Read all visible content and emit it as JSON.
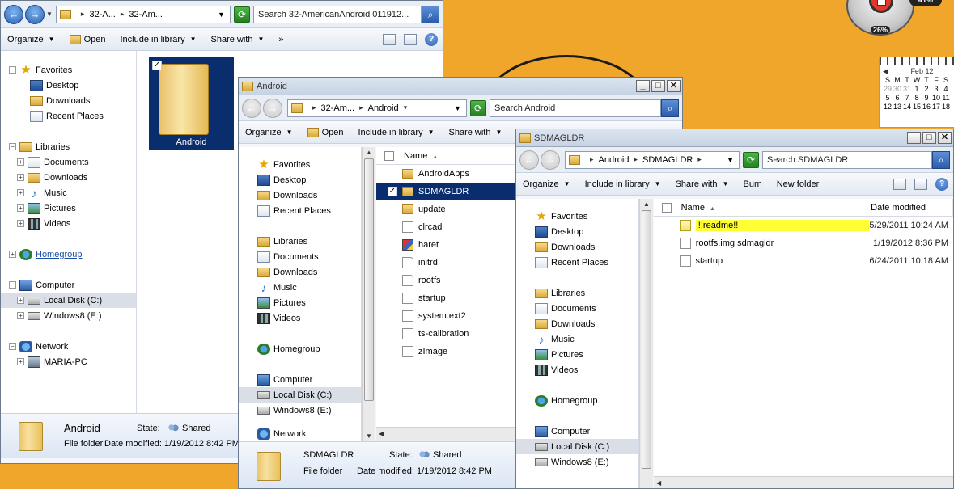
{
  "desktop": {
    "cpu_percent": "26%",
    "mem_percent": "41%",
    "calendar": {
      "month": "Feb 12",
      "weekdays": [
        "S",
        "M",
        "T",
        "W",
        "T",
        "F",
        "S"
      ],
      "rows": [
        [
          "29",
          "30",
          "31",
          "1",
          "2",
          "3",
          "4"
        ],
        [
          "5",
          "6",
          "7",
          "8",
          "9",
          "10",
          "11"
        ],
        [
          "12",
          "13",
          "14",
          "15",
          "16",
          "17",
          "18"
        ]
      ]
    }
  },
  "win1": {
    "crumbs": [
      "32-A...",
      "32-Am..."
    ],
    "search_placeholder": "Search 32-AmericanAndroid 011912...",
    "cmd": {
      "organize": "Organize",
      "open": "Open",
      "include": "Include in library",
      "share": "Share with",
      "more": "»"
    },
    "nav": {
      "favorites": "Favorites",
      "desktop": "Desktop",
      "downloads": "Downloads",
      "recent": "Recent Places",
      "libraries": "Libraries",
      "documents": "Documents",
      "lib_downloads": "Downloads",
      "music": "Music",
      "pictures": "Pictures",
      "videos": "Videos",
      "homegroup": "Homegroup",
      "computer": "Computer",
      "localdisk": "Local Disk (C:)",
      "windows8": "Windows8 (E:)",
      "network": "Network",
      "mariapc": "MARIA-PC"
    },
    "item": "Android",
    "details": {
      "name": "Android",
      "state_label": "State:",
      "state": "Shared",
      "type": "File folder",
      "date_label": "Date modified:",
      "date": "1/19/2012 8:42 PM"
    }
  },
  "win2": {
    "title": "Android",
    "crumbs": [
      "32-Am...",
      "Android"
    ],
    "search_placeholder": "Search Android",
    "cmd": {
      "organize": "Organize",
      "open": "Open",
      "include": "Include in library",
      "share": "Share with"
    },
    "nav": {
      "favorites": "Favorites",
      "desktop": "Desktop",
      "downloads": "Downloads",
      "recent": "Recent Places",
      "libraries": "Libraries",
      "documents": "Documents",
      "lib_downloads": "Downloads",
      "music": "Music",
      "pictures": "Pictures",
      "videos": "Videos",
      "homegroup": "Homegroup",
      "computer": "Computer",
      "localdisk": "Local Disk (C:)",
      "windows8": "Windows8 (E:)",
      "network": "Network"
    },
    "col_name": "Name",
    "files": [
      "AndroidApps",
      "SDMAGLDR",
      "update",
      "clrcad",
      "haret",
      "initrd",
      "rootfs",
      "startup",
      "system.ext2",
      "ts-calibration",
      "zImage"
    ],
    "details": {
      "name": "SDMAGLDR",
      "state_label": "State:",
      "state": "Shared",
      "type": "File folder",
      "date_label": "Date modified:",
      "date": "1/19/2012 8:42 PM"
    }
  },
  "win3": {
    "title": "SDMAGLDR",
    "crumbs": [
      "Android",
      "SDMAGLDR"
    ],
    "search_placeholder": "Search SDMAGLDR",
    "cmd": {
      "organize": "Organize",
      "include": "Include in library",
      "share": "Share with",
      "burn": "Burn",
      "newfolder": "New folder"
    },
    "nav": {
      "favorites": "Favorites",
      "desktop": "Desktop",
      "downloads": "Downloads",
      "recent": "Recent Places",
      "libraries": "Libraries",
      "documents": "Documents",
      "lib_downloads": "Downloads",
      "music": "Music",
      "pictures": "Pictures",
      "videos": "Videos",
      "homegroup": "Homegroup",
      "computer": "Computer",
      "localdisk": "Local Disk (C:)",
      "windows8": "Windows8 (E:)"
    },
    "col_name": "Name",
    "col_date": "Date modified",
    "files": [
      {
        "name": "!!readme!!",
        "date": "5/29/2011 10:24 AM"
      },
      {
        "name": "rootfs.img.sdmagldr",
        "date": "1/19/2012 8:36 PM"
      },
      {
        "name": "startup",
        "date": "6/24/2011 10:18 AM"
      }
    ]
  }
}
